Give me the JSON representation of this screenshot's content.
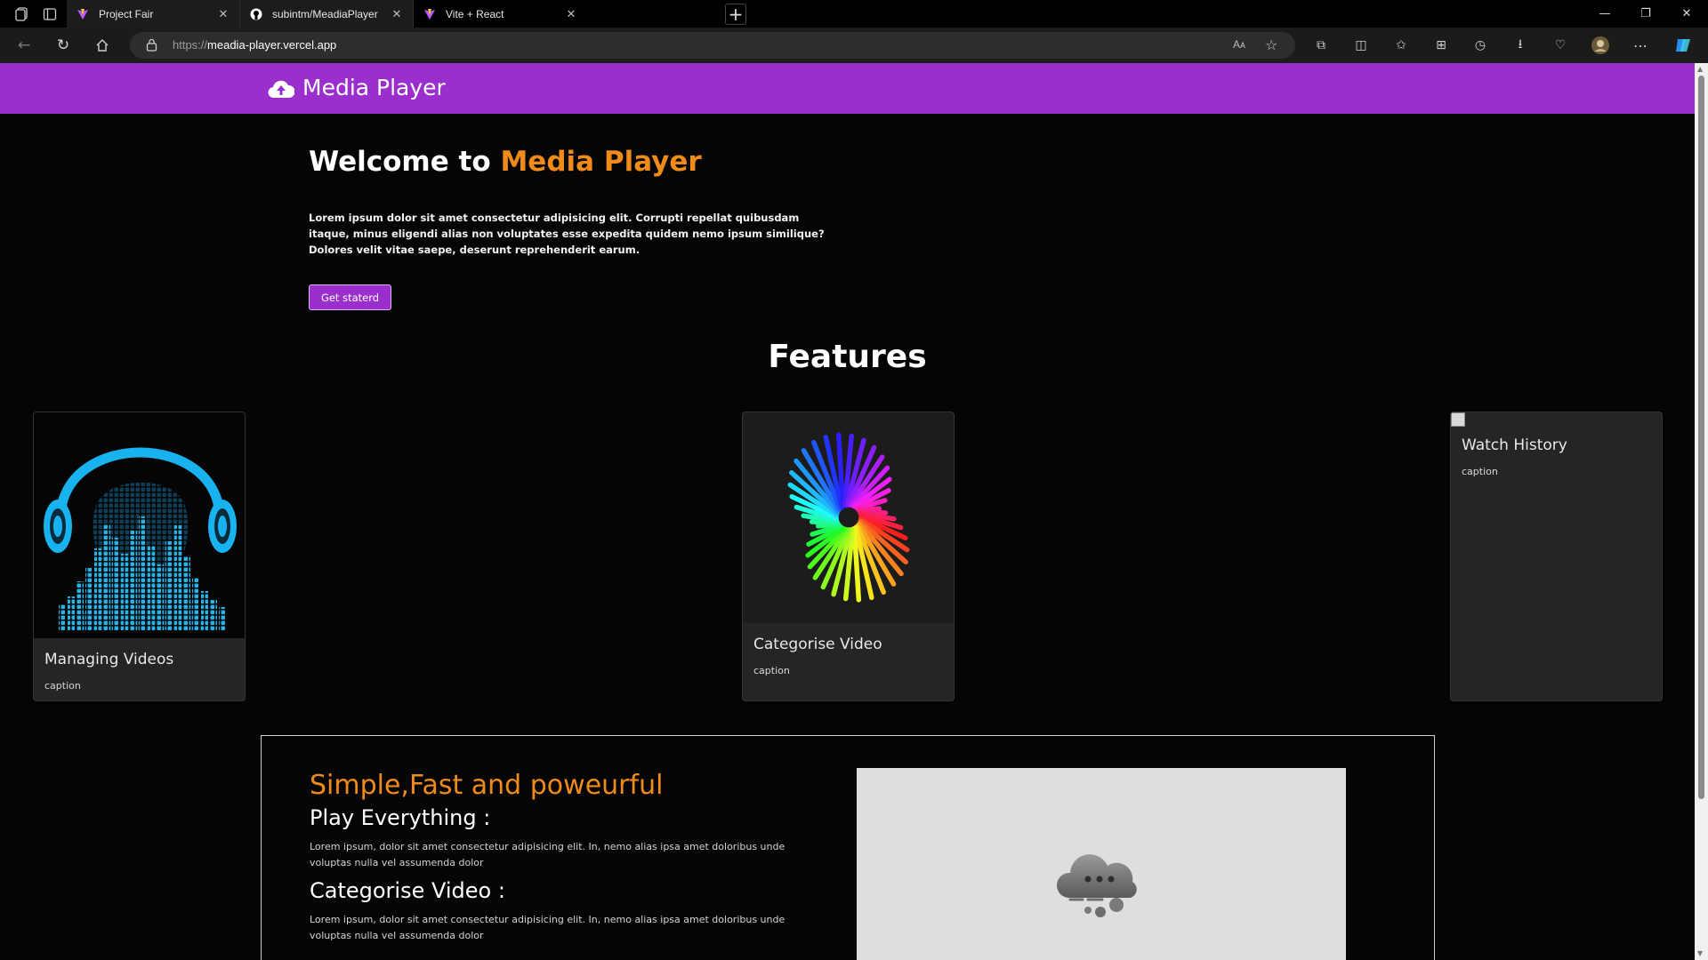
{
  "browser": {
    "tabs": [
      {
        "title": "Project Fair",
        "active": false
      },
      {
        "title": "subintm/MeadiaPlayer",
        "active": false
      },
      {
        "title": "Vite + React",
        "active": true
      }
    ],
    "address": {
      "protocol": "https://",
      "host": "meadia-player.vercel.app"
    },
    "read_aloud_label": "Aᴀ"
  },
  "navbar": {
    "brand": "Media Player",
    "brand_icon": "cloud-upload-icon",
    "color": "#9b2fce"
  },
  "hero": {
    "title_prefix": "Welcome to ",
    "title_accent": "Media Player",
    "accent_color": "#f08a18",
    "description": "Lorem ipsum dolor sit amet consectetur adipisicing elit. Corrupti repellat quibusdam itaque, minus eligendi alias non voluptates esse expedita quidem nemo ipsum similique? Dolores velit vitae saepe, deserunt reprehenderit earum.",
    "button_label": "Get staterd"
  },
  "features": {
    "title": "Features",
    "cards": [
      {
        "title": "Managing Videos",
        "caption": "caption",
        "image": "headphones-equalizer-image"
      },
      {
        "title": "Categorise Video",
        "caption": "caption",
        "image": "rainbow-spiral-image"
      },
      {
        "title": "Watch History",
        "caption": "caption",
        "image": "broken-image"
      }
    ]
  },
  "promo": {
    "title": "Simple,Fast and poweurful",
    "sections": [
      {
        "heading": "Play Everything :",
        "text": "Lorem ipsum, dolor sit amet consectetur adipisicing elit. In, nemo alias ipsa amet doloribus unde voluptas nulla vel assumenda dolor"
      },
      {
        "heading": "Categorise Video :",
        "text": "Lorem ipsum, dolor sit amet consectetur adipisicing elit. In, nemo alias ipsa amet doloribus unde voluptas nulla vel assumenda dolor"
      }
    ],
    "video_placeholder_icon": "cloud-loading-icon"
  }
}
